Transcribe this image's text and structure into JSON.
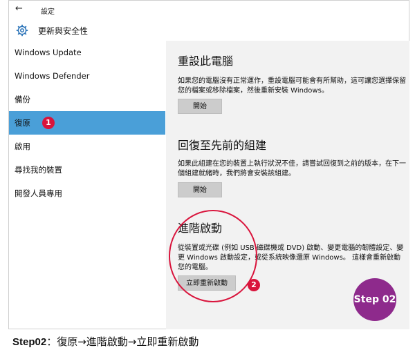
{
  "titlebar": {
    "title": "設定"
  },
  "header": {
    "title": "更新與安全性",
    "icon": "gear-icon"
  },
  "sidebar": {
    "items": [
      {
        "label": "Windows Update"
      },
      {
        "label": "Windows Defender"
      },
      {
        "label": "備份"
      },
      {
        "label": "復原",
        "active": true
      },
      {
        "label": "啟用"
      },
      {
        "label": "尋找我的裝置"
      },
      {
        "label": "開發人員專用"
      }
    ],
    "badge": "1"
  },
  "content": {
    "sections": [
      {
        "title": "重設此電腦",
        "desc": "如果您的電腦沒有正常運作，重設電腦可能會有所幫助，這可讓您選擇保留您的檔案或移除檔案，然後重新安裝 Windows。",
        "button": "開始"
      },
      {
        "title": "回復至先前的組建",
        "desc": "如果此組建在您的裝置上執行狀況不佳，請嘗試回復到之前的版本，在下一個組建就緒時，我們將會安裝該組建。",
        "button": "開始"
      },
      {
        "title": "進階啟動",
        "desc": "從裝置或光碟 (例如 USB 磁碟機或 DVD) 啟動、變更電腦的韌體設定、變更 Windows 啟動設定，或從系統映像還原 Windows。 這樣會重新啟動您的電腦。",
        "button": "立即重新啟動"
      }
    ],
    "badge": "2",
    "step_label": "Step 02"
  },
  "caption": {
    "step": "Step02",
    "text": "：復原→進階啟動→立即重新啟動"
  },
  "colors": {
    "accent": "#4a9fd8",
    "badge": "#d9143c",
    "step": "#8e2a8c"
  }
}
